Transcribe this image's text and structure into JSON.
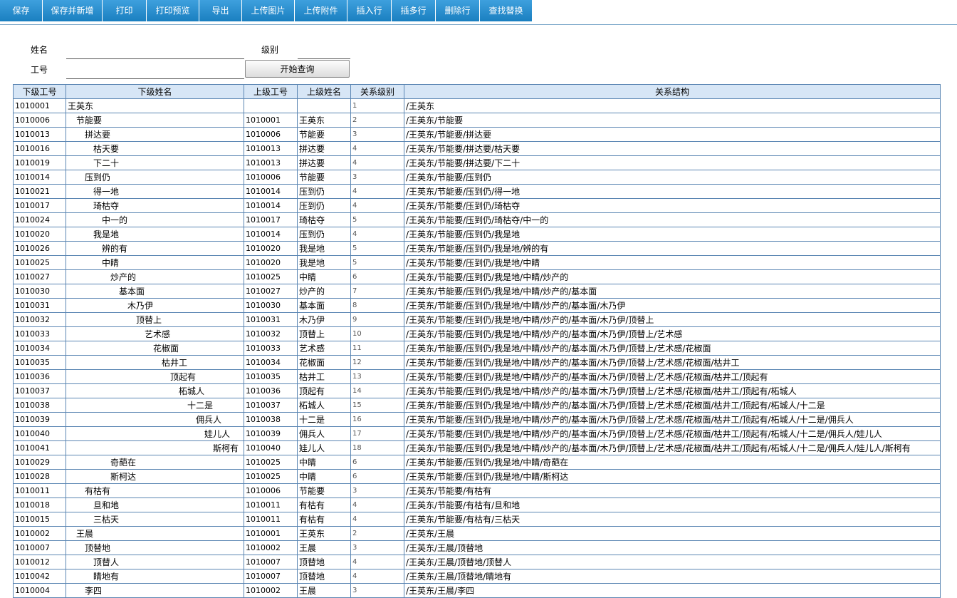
{
  "toolbar": {
    "buttons": [
      {
        "label": "保存",
        "name": "save-button",
        "w": 60
      },
      {
        "label": "保存并新增",
        "name": "save-and-new-button",
        "w": 84
      },
      {
        "label": "打印",
        "name": "print-button",
        "w": 62
      },
      {
        "label": "打印预览",
        "name": "print-preview-button",
        "w": 74
      },
      {
        "label": "导出",
        "name": "export-button",
        "w": 60
      },
      {
        "label": "上传图片",
        "name": "upload-image-button",
        "w": 74
      },
      {
        "label": "上传附件",
        "name": "upload-attachment-button",
        "w": 74
      },
      {
        "label": "插入行",
        "name": "insert-row-button",
        "w": 62
      },
      {
        "label": "插多行",
        "name": "insert-multiple-rows-button",
        "w": 62
      },
      {
        "label": "删除行",
        "name": "delete-row-button",
        "w": 62
      },
      {
        "label": "查找替换",
        "name": "find-replace-button",
        "w": 74
      }
    ]
  },
  "form": {
    "name_label": "姓名",
    "name_value": "",
    "level_label": "级别",
    "level_value": "",
    "id_label": "工号",
    "id_value": "",
    "query_button": "开始查询"
  },
  "grid": {
    "columns": [
      {
        "label": "下级工号",
        "name": "col-sub-id",
        "w": 74
      },
      {
        "label": "下级姓名",
        "name": "col-sub-name",
        "w": 250
      },
      {
        "label": "上级工号",
        "name": "col-parent-id",
        "w": 75
      },
      {
        "label": "上级姓名",
        "name": "col-parent-name",
        "w": 75
      },
      {
        "label": "关系级别",
        "name": "col-level",
        "w": 75
      },
      {
        "label": "关系结构",
        "name": "col-structure",
        "w": 753
      }
    ],
    "rows": [
      {
        "id": "1010001",
        "name": "王英东",
        "pid": "",
        "pname": "",
        "level": 1,
        "path": "/王英东"
      },
      {
        "id": "1010006",
        "name": "节能要",
        "pid": "1010001",
        "pname": "王英东",
        "level": 2,
        "path": "/王英东/节能要"
      },
      {
        "id": "1010013",
        "name": "拼达要",
        "pid": "1010006",
        "pname": "节能要",
        "level": 3,
        "path": "/王英东/节能要/拼达要"
      },
      {
        "id": "1010016",
        "name": "枯天要",
        "pid": "1010013",
        "pname": "拼达要",
        "level": 4,
        "path": "/王英东/节能要/拼达要/枯天要"
      },
      {
        "id": "1010019",
        "name": "下二十",
        "pid": "1010013",
        "pname": "拼达要",
        "level": 4,
        "path": "/王英东/节能要/拼达要/下二十"
      },
      {
        "id": "1010014",
        "name": "压到仍",
        "pid": "1010006",
        "pname": "节能要",
        "level": 3,
        "path": "/王英东/节能要/压到仍"
      },
      {
        "id": "1010021",
        "name": "得一地",
        "pid": "1010014",
        "pname": "压到仍",
        "level": 4,
        "path": "/王英东/节能要/压到仍/得一地"
      },
      {
        "id": "1010017",
        "name": "琦枯夺",
        "pid": "1010014",
        "pname": "压到仍",
        "level": 4,
        "path": "/王英东/节能要/压到仍/琦枯夺"
      },
      {
        "id": "1010024",
        "name": "中一的",
        "pid": "1010017",
        "pname": "琦枯夺",
        "level": 5,
        "path": "/王英东/节能要/压到仍/琦枯夺/中一的"
      },
      {
        "id": "1010020",
        "name": "我是地",
        "pid": "1010014",
        "pname": "压到仍",
        "level": 4,
        "path": "/王英东/节能要/压到仍/我是地"
      },
      {
        "id": "1010026",
        "name": "辨的有",
        "pid": "1010020",
        "pname": "我是地",
        "level": 5,
        "path": "/王英东/节能要/压到仍/我是地/辨的有"
      },
      {
        "id": "1010025",
        "name": "中睛",
        "pid": "1010020",
        "pname": "我是地",
        "level": 5,
        "path": "/王英东/节能要/压到仍/我是地/中睛"
      },
      {
        "id": "1010027",
        "name": "炒产的",
        "pid": "1010025",
        "pname": "中睛",
        "level": 6,
        "path": "/王英东/节能要/压到仍/我是地/中睛/炒产的"
      },
      {
        "id": "1010030",
        "name": "基本面",
        "pid": "1010027",
        "pname": "炒产的",
        "level": 7,
        "path": "/王英东/节能要/压到仍/我是地/中睛/炒产的/基本面"
      },
      {
        "id": "1010031",
        "name": "木乃伊",
        "pid": "1010030",
        "pname": "基本面",
        "level": 8,
        "path": "/王英东/节能要/压到仍/我是地/中睛/炒产的/基本面/木乃伊"
      },
      {
        "id": "1010032",
        "name": "顶替上",
        "pid": "1010031",
        "pname": "木乃伊",
        "level": 9,
        "path": "/王英东/节能要/压到仍/我是地/中睛/炒产的/基本面/木乃伊/顶替上"
      },
      {
        "id": "1010033",
        "name": "艺术感",
        "pid": "1010032",
        "pname": "顶替上",
        "level": 10,
        "path": "/王英东/节能要/压到仍/我是地/中睛/炒产的/基本面/木乃伊/顶替上/艺术感"
      },
      {
        "id": "1010034",
        "name": "花椒面",
        "pid": "1010033",
        "pname": "艺术感",
        "level": 11,
        "path": "/王英东/节能要/压到仍/我是地/中睛/炒产的/基本面/木乃伊/顶替上/艺术感/花椒面"
      },
      {
        "id": "1010035",
        "name": "枯井工",
        "pid": "1010034",
        "pname": "花椒面",
        "level": 12,
        "path": "/王英东/节能要/压到仍/我是地/中睛/炒产的/基本面/木乃伊/顶替上/艺术感/花椒面/枯井工"
      },
      {
        "id": "1010036",
        "name": "顶起有",
        "pid": "1010035",
        "pname": "枯井工",
        "level": 13,
        "path": "/王英东/节能要/压到仍/我是地/中睛/炒产的/基本面/木乃伊/顶替上/艺术感/花椒面/枯井工/顶起有"
      },
      {
        "id": "1010037",
        "name": "柘城人",
        "pid": "1010036",
        "pname": "顶起有",
        "level": 14,
        "path": "/王英东/节能要/压到仍/我是地/中睛/炒产的/基本面/木乃伊/顶替上/艺术感/花椒面/枯井工/顶起有/柘城人"
      },
      {
        "id": "1010038",
        "name": "十二是",
        "pid": "1010037",
        "pname": "柘城人",
        "level": 15,
        "path": "/王英东/节能要/压到仍/我是地/中睛/炒产的/基本面/木乃伊/顶替上/艺术感/花椒面/枯井工/顶起有/柘城人/十二是"
      },
      {
        "id": "1010039",
        "name": "佣兵人",
        "pid": "1010038",
        "pname": "十二是",
        "level": 16,
        "path": "/王英东/节能要/压到仍/我是地/中睛/炒产的/基本面/木乃伊/顶替上/艺术感/花椒面/枯井工/顶起有/柘城人/十二是/佣兵人"
      },
      {
        "id": "1010040",
        "name": "娃儿人",
        "pid": "1010039",
        "pname": "佣兵人",
        "level": 17,
        "path": "/王英东/节能要/压到仍/我是地/中睛/炒产的/基本面/木乃伊/顶替上/艺术感/花椒面/枯井工/顶起有/柘城人/十二是/佣兵人/娃儿人"
      },
      {
        "id": "1010041",
        "name": "斯柯有",
        "pid": "1010040",
        "pname": "娃儿人",
        "level": 18,
        "path": "/王英东/节能要/压到仍/我是地/中睛/炒产的/基本面/木乃伊/顶替上/艺术感/花椒面/枯井工/顶起有/柘城人/十二是/佣兵人/娃儿人/斯柯有"
      },
      {
        "id": "1010029",
        "name": "奇葩在",
        "pid": "1010025",
        "pname": "中睛",
        "level": 6,
        "path": "/王英东/节能要/压到仍/我是地/中睛/奇葩在"
      },
      {
        "id": "1010028",
        "name": "斯柯达",
        "pid": "1010025",
        "pname": "中睛",
        "level": 6,
        "path": "/王英东/节能要/压到仍/我是地/中睛/斯柯达"
      },
      {
        "id": "1010011",
        "name": "有枯有",
        "pid": "1010006",
        "pname": "节能要",
        "level": 3,
        "path": "/王英东/节能要/有枯有"
      },
      {
        "id": "1010018",
        "name": "旦和地",
        "pid": "1010011",
        "pname": "有枯有",
        "level": 4,
        "path": "/王英东/节能要/有枯有/旦和地"
      },
      {
        "id": "1010015",
        "name": "三枯天",
        "pid": "1010011",
        "pname": "有枯有",
        "level": 4,
        "path": "/王英东/节能要/有枯有/三枯天"
      },
      {
        "id": "1010002",
        "name": "王晨",
        "pid": "1010001",
        "pname": "王英东",
        "level": 2,
        "path": "/王英东/王晨"
      },
      {
        "id": "1010007",
        "name": "顶替地",
        "pid": "1010002",
        "pname": "王晨",
        "level": 3,
        "path": "/王英东/王晨/顶替地"
      },
      {
        "id": "1010012",
        "name": "顶替人",
        "pid": "1010007",
        "pname": "顶替地",
        "level": 4,
        "path": "/王英东/王晨/顶替地/顶替人"
      },
      {
        "id": "1010042",
        "name": "睛地有",
        "pid": "1010007",
        "pname": "顶替地",
        "level": 4,
        "path": "/王英东/王晨/顶替地/睛地有"
      },
      {
        "id": "1010004",
        "name": "李四",
        "pid": "1010002",
        "pname": "王晨",
        "level": 3,
        "path": "/王英东/王晨/李四"
      }
    ]
  }
}
